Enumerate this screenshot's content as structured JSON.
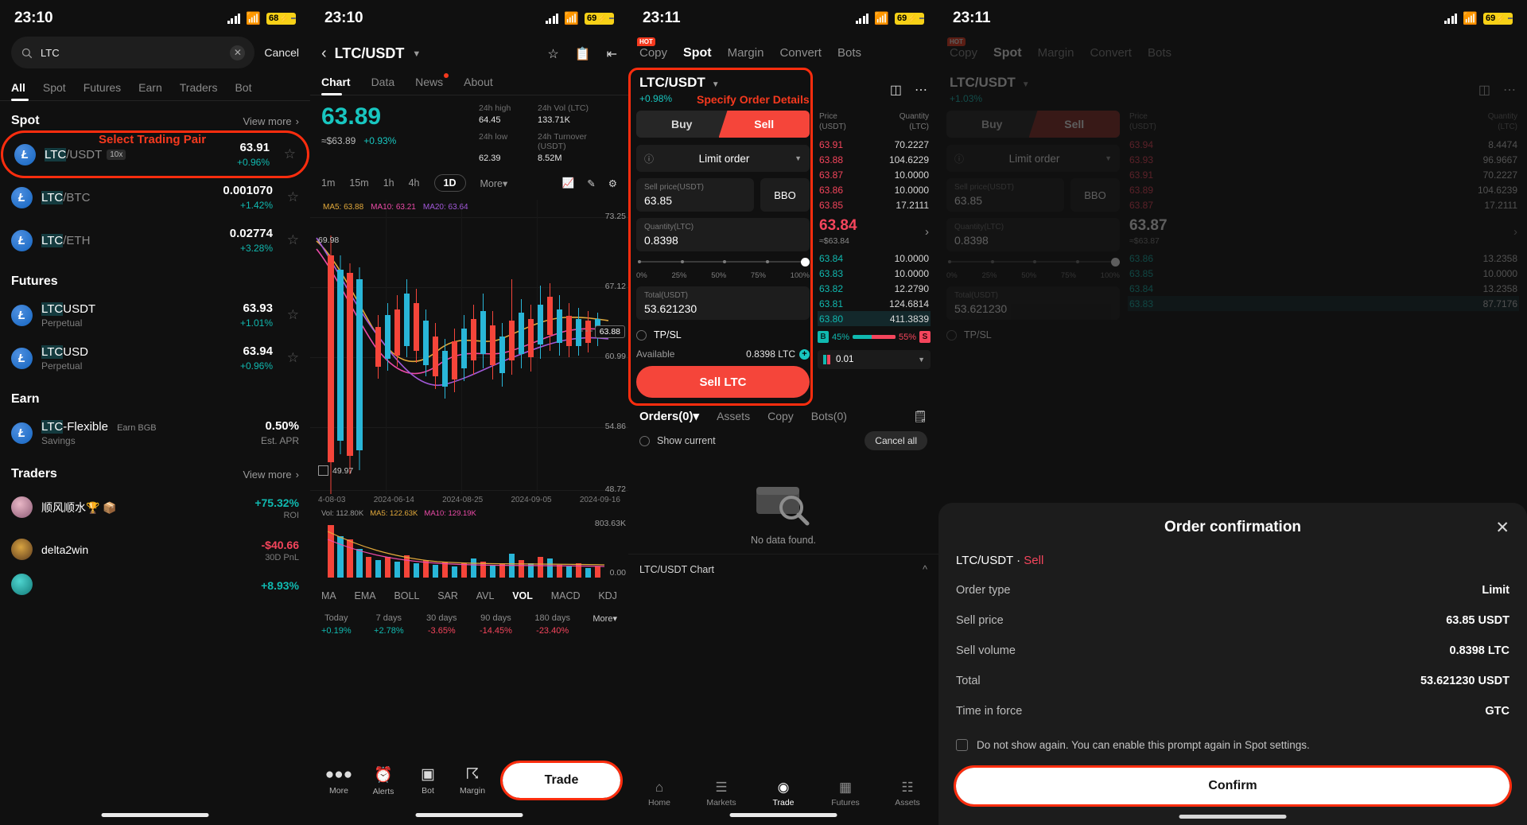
{
  "panel1": {
    "status": {
      "time": "23:10",
      "battery": "68"
    },
    "search": {
      "value": "LTC",
      "placeholder": "Search",
      "cancel": "Cancel"
    },
    "tabs": [
      {
        "label": "All",
        "active": true
      },
      {
        "label": "Spot",
        "active": false
      },
      {
        "label": "Futures",
        "active": false
      },
      {
        "label": "Earn",
        "active": false
      },
      {
        "label": "Traders",
        "active": false
      },
      {
        "label": "Bot",
        "active": false
      }
    ],
    "annotation": "Select Trading Pair",
    "sections": [
      {
        "title": "Spot",
        "more": "View more"
      },
      {
        "title": "Futures",
        "more": ""
      },
      {
        "title": "Earn",
        "more": ""
      },
      {
        "title": "Traders",
        "more": "View more"
      }
    ],
    "spot": [
      {
        "base": "LTC",
        "quote": "/USDT",
        "lev": "10x",
        "price": "63.91",
        "chg": "+0.96%",
        "highlight": true
      },
      {
        "base": "LTC",
        "quote": "/BTC",
        "lev": "",
        "price": "0.001070",
        "chg": "+1.42%",
        "highlight": false
      },
      {
        "base": "LTC",
        "quote": "/ETH",
        "lev": "",
        "price": "0.02774",
        "chg": "+3.28%",
        "highlight": false
      }
    ],
    "futures": [
      {
        "base": "LTC",
        "quote": "USDT",
        "sub": "Perpetual",
        "price": "63.93",
        "chg": "+1.01%"
      },
      {
        "base": "LTC",
        "quote": "USD",
        "sub": "Perpetual",
        "price": "63.94",
        "chg": "+0.96%"
      }
    ],
    "earn": [
      {
        "base": "LTC",
        "quote": "-Flexible",
        "tag": "Earn BGB",
        "sub": "Savings",
        "price": "0.50%",
        "chg": "Est. APR"
      }
    ],
    "traders": [
      {
        "name": "顺风顺水🏆 📦",
        "roi": "+75.32%",
        "roilabel": "ROI"
      },
      {
        "name": "delta2win",
        "roi": "-$40.66",
        "roilabel": "30D PnL"
      },
      {
        "name": "",
        "roi": "+8.93%",
        "roilabel": ""
      }
    ]
  },
  "panel2": {
    "status": {
      "time": "23:10",
      "battery": "69"
    },
    "pair": "LTC/USDT",
    "tabs": [
      {
        "label": "Chart",
        "active": true
      },
      {
        "label": "Data",
        "active": false
      },
      {
        "label": "News",
        "active": false,
        "dot": true
      },
      {
        "label": "About",
        "active": false
      }
    ],
    "price": "63.89",
    "price_usd": "≈$63.89",
    "price_change": "+0.93%",
    "stats": [
      {
        "label": "24h high",
        "value": "64.45"
      },
      {
        "label": "24h Vol (LTC)",
        "value": "133.71K"
      },
      {
        "label": "24h low",
        "value": "62.39"
      },
      {
        "label": "24h Turnover (USDT)",
        "value": "8.52M"
      }
    ],
    "timeframes": [
      {
        "label": "1m",
        "active": false
      },
      {
        "label": "15m",
        "active": false
      },
      {
        "label": "1h",
        "active": false
      },
      {
        "label": "4h",
        "active": false
      },
      {
        "label": "1D",
        "active": true
      },
      {
        "label": "More",
        "active": false
      }
    ],
    "ma": [
      {
        "label": "MA5: 63.88",
        "color": "#e2a93b"
      },
      {
        "label": "MA10: 63.21",
        "color": "#ec4ba8"
      },
      {
        "label": "MA20: 63.64",
        "color": "#a259d9"
      }
    ],
    "vol_ma": [
      {
        "label": "Vol: 112.80K",
        "color": "#9a9a9a"
      },
      {
        "label": "MA5: 122.63K",
        "color": "#e2a93b"
      },
      {
        "label": "MA10: 129.19K",
        "color": "#ec4ba8"
      }
    ],
    "y_labels": [
      "73.25",
      "67.12",
      "60.99",
      "54.86",
      "48.72"
    ],
    "vol_y_labels": [
      "803.63K",
      "0.00"
    ],
    "x_labels": [
      "4-08-03",
      "2024-06-14",
      "2024-08-25",
      "2024-09-05",
      "2024-09-16"
    ],
    "marker_high": "69.98",
    "marker_low": "49.97",
    "last_tag": "63.88",
    "indicators": [
      {
        "label": "MA",
        "active": false
      },
      {
        "label": "EMA",
        "active": false
      },
      {
        "label": "BOLL",
        "active": false
      },
      {
        "label": "SAR",
        "active": false
      },
      {
        "label": "AVL",
        "active": false
      },
      {
        "label": "VOL",
        "active": true
      },
      {
        "label": "MACD",
        "active": false
      },
      {
        "label": "KDJ",
        "active": false
      }
    ],
    "performance": [
      {
        "label": "Today",
        "value": "+0.19%",
        "down": false
      },
      {
        "label": "7 days",
        "value": "+2.78%",
        "down": false
      },
      {
        "label": "30 days",
        "value": "-3.65%",
        "down": true
      },
      {
        "label": "90 days",
        "value": "-14.45%",
        "down": true
      },
      {
        "label": "180 days",
        "value": "-23.40%",
        "down": true
      },
      {
        "label": "More",
        "value": "",
        "down": false
      }
    ],
    "bottom": [
      {
        "label": "More",
        "icon": "dots-icon"
      },
      {
        "label": "Alerts",
        "icon": "alert-icon"
      },
      {
        "label": "Bot",
        "icon": "bot-icon"
      },
      {
        "label": "Margin",
        "icon": "margin-icon"
      }
    ],
    "trade_button": "Trade"
  },
  "panel3": {
    "status": {
      "time": "23:11",
      "battery": "69"
    },
    "topnav": [
      {
        "label": "Copy",
        "active": false,
        "badge": "HOT"
      },
      {
        "label": "Spot",
        "active": true,
        "badge": ""
      },
      {
        "label": "Margin",
        "active": false,
        "badge": ""
      },
      {
        "label": "Convert",
        "active": false,
        "badge": ""
      },
      {
        "label": "Bots",
        "active": false,
        "badge": ""
      }
    ],
    "annotation": "Specify Order Details",
    "pair": "LTC/USDT",
    "pair_change": "+0.98%",
    "side": {
      "buy": "Buy",
      "sell": "Sell",
      "active": "Sell"
    },
    "order_type": "Limit order",
    "price_field": {
      "label": "Sell price(USDT)",
      "value": "63.85"
    },
    "bbo": "BBO",
    "qty_field": {
      "label": "Quantity(LTC)",
      "value": "0.8398"
    },
    "slider_ticks": [
      "0%",
      "25%",
      "50%",
      "75%",
      "100%"
    ],
    "total_field": {
      "label": "Total(USDT)",
      "value": "53.621230"
    },
    "tpsl": "TP/SL",
    "available_label": "Available",
    "available_value": "0.8398 LTC",
    "submit": "Sell LTC",
    "book_headers": {
      "price": "Price (USDT)",
      "qty": "Quantity (LTC)"
    },
    "asks": [
      {
        "price": "63.91",
        "qty": "70.2227"
      },
      {
        "price": "63.88",
        "qty": "104.6229"
      },
      {
        "price": "63.87",
        "qty": "10.0000"
      },
      {
        "price": "63.86",
        "qty": "10.0000"
      },
      {
        "price": "63.85",
        "qty": "17.2111"
      }
    ],
    "mid": {
      "price": "63.84",
      "usd": "≈$63.84"
    },
    "bids": [
      {
        "price": "63.84",
        "qty": "10.0000"
      },
      {
        "price": "63.83",
        "qty": "10.0000"
      },
      {
        "price": "63.82",
        "qty": "12.2790"
      },
      {
        "price": "63.81",
        "qty": "124.6814"
      },
      {
        "price": "63.80",
        "qty": "411.3839"
      }
    ],
    "ratio": {
      "buy_label": "B",
      "buy_pct": "45%",
      "sell_pct": "55%",
      "sell_label": "S"
    },
    "depth": "0.01",
    "order_tabs": [
      {
        "label": "Orders(0)",
        "active": true
      },
      {
        "label": "Assets",
        "active": false
      },
      {
        "label": "Copy",
        "active": false
      },
      {
        "label": "Bots(0)",
        "active": false
      }
    ],
    "show_current": "Show current",
    "cancel_all": "Cancel all",
    "no_data": "No data found.",
    "chart_link": "LTC/USDT  Chart",
    "navtabs": [
      {
        "label": "Home",
        "active": false
      },
      {
        "label": "Markets",
        "active": false
      },
      {
        "label": "Trade",
        "active": true
      },
      {
        "label": "Futures",
        "active": false
      },
      {
        "label": "Assets",
        "active": false
      }
    ]
  },
  "panel4": {
    "status": {
      "time": "23:11",
      "battery": "69"
    },
    "topnav": [
      {
        "label": "Copy",
        "active": false,
        "badge": "HOT"
      },
      {
        "label": "Spot",
        "active": true,
        "badge": ""
      },
      {
        "label": "Margin",
        "active": false,
        "badge": ""
      },
      {
        "label": "Convert",
        "active": false,
        "badge": ""
      },
      {
        "label": "Bots",
        "active": false,
        "badge": ""
      }
    ],
    "pair": "LTC/USDT",
    "pair_change": "+1.03%",
    "side": {
      "buy": "Buy",
      "sell": "Sell"
    },
    "order_type": "Limit order",
    "price_field": {
      "label": "Sell price(USDT)",
      "value": "63.85"
    },
    "bbo": "BBO",
    "qty_field": {
      "label": "Quantity(LTC)",
      "value": "0.8398"
    },
    "slider_ticks": [
      "0%",
      "25%",
      "50%",
      "75%",
      "100%"
    ],
    "total_field": {
      "label": "Total(USDT)",
      "value": "53.621230"
    },
    "tpsl": "TP/SL",
    "book_headers": {
      "price": "Price (USDT)",
      "qty": "Quantity (LTC)"
    },
    "asks": [
      {
        "price": "63.94",
        "qty": "8.4474"
      },
      {
        "price": "63.93",
        "qty": "96.9667"
      },
      {
        "price": "63.91",
        "qty": "70.2227"
      },
      {
        "price": "63.89",
        "qty": "104.6239"
      },
      {
        "price": "63.87",
        "qty": "17.2111"
      }
    ],
    "mid": {
      "price": "63.87",
      "usd": "≈$63.87"
    },
    "bids": [
      {
        "price": "63.86",
        "qty": "13.2358"
      },
      {
        "price": "63.85",
        "qty": "10.0000"
      },
      {
        "price": "63.84",
        "qty": "13.2358"
      },
      {
        "price": "63.83",
        "qty": "87.7176"
      }
    ],
    "dialog": {
      "title": "Order confirmation",
      "pair_line_main": "LTC/USDT · ",
      "pair_line_side": "Sell",
      "rows": [
        {
          "key": "Order type",
          "value": "Limit"
        },
        {
          "key": "Sell price",
          "value": "63.85 USDT"
        },
        {
          "key": "Sell volume",
          "value": "0.8398 LTC"
        },
        {
          "key": "Total",
          "value": "53.621230 USDT"
        },
        {
          "key": "Time in force",
          "value": "GTC"
        }
      ],
      "checkbox": "Do not show again. You can enable this prompt again in Spot settings.",
      "confirm": "Confirm"
    }
  }
}
